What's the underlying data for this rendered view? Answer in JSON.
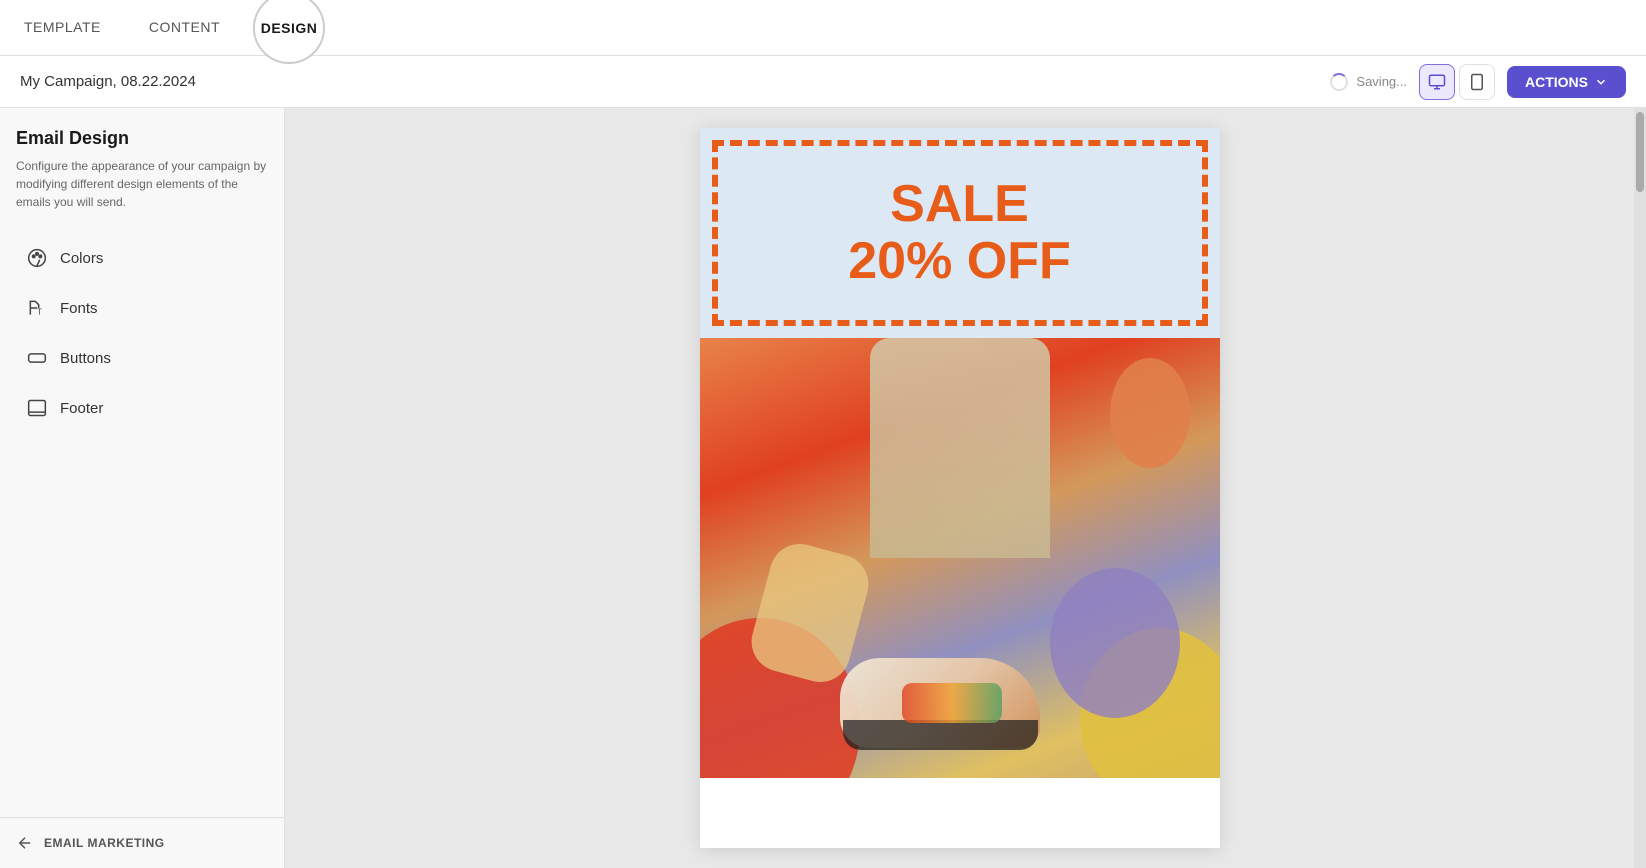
{
  "tabs": [
    {
      "id": "template",
      "label": "TEMPLATE",
      "active": false
    },
    {
      "id": "content",
      "label": "CONTENT",
      "active": false
    },
    {
      "id": "design",
      "label": "DESIGN",
      "active": true
    }
  ],
  "campaign": {
    "title": "My Campaign, 08.22.2024",
    "saving_text": "Saving..."
  },
  "actions_button": "ACTIONS",
  "sidebar": {
    "title": "Email Design",
    "description": "Configure the appearance of your campaign by modifying different design elements of the emails you will send.",
    "items": [
      {
        "id": "colors",
        "label": "Colors",
        "icon": "palette"
      },
      {
        "id": "fonts",
        "label": "Fonts",
        "icon": "type"
      },
      {
        "id": "buttons",
        "label": "Buttons",
        "icon": "button"
      },
      {
        "id": "footer",
        "label": "Footer",
        "icon": "footer"
      }
    ],
    "footer_label": "EMAIL MARKETING"
  },
  "email_preview": {
    "sale_line1": "SALE",
    "sale_line2": "20% OFF"
  }
}
